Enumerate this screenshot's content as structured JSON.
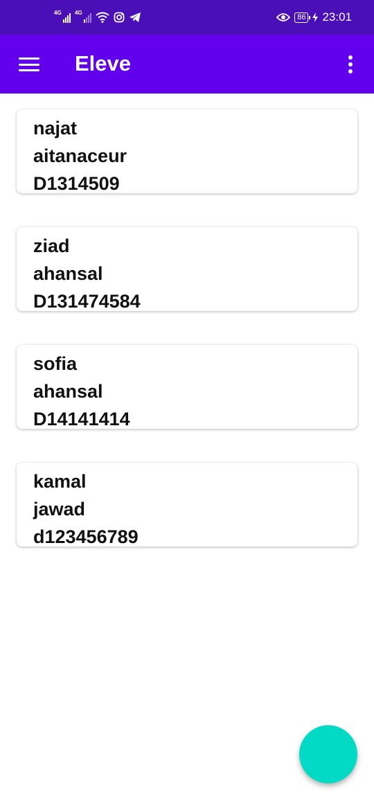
{
  "status_bar": {
    "network_1": "4G",
    "network_2": "4G",
    "battery": "86",
    "time": "23:01",
    "icons": [
      "signal-icon",
      "signal-icon",
      "wifi-icon",
      "instagram-icon",
      "telegram-icon",
      "eye-icon",
      "battery-icon",
      "charging-icon"
    ]
  },
  "app_bar": {
    "title": "Eleve",
    "menu_icon": "hamburger-menu-icon",
    "overflow_icon": "more-vert-icon"
  },
  "students": [
    {
      "first_name": "najat",
      "last_name": "aitanaceur",
      "code": "D1314509"
    },
    {
      "first_name": "ziad",
      "last_name": "ahansal",
      "code": "D131474584"
    },
    {
      "first_name": "sofia",
      "last_name": "ahansal",
      "code": "D14141414"
    },
    {
      "first_name": "kamal",
      "last_name": "jawad",
      "code": "d123456789"
    }
  ],
  "fab": {
    "icon": "fab-icon",
    "color": "#03dac5"
  },
  "colors": {
    "status_bar": "#4a0fb7",
    "app_bar": "#6200ee",
    "accent": "#03dac5"
  }
}
